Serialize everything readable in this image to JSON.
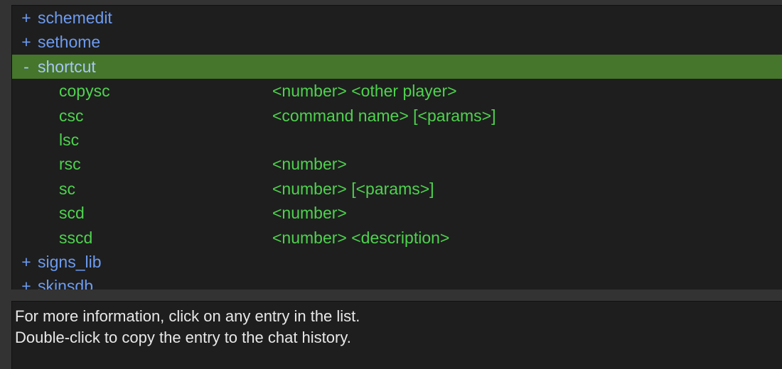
{
  "list": {
    "rows": [
      {
        "kind": "mod",
        "toggle": "+",
        "label": "schemedit",
        "selected": false
      },
      {
        "kind": "mod",
        "toggle": "+",
        "label": "sethome",
        "selected": false
      },
      {
        "kind": "mod",
        "toggle": "-",
        "label": "shortcut",
        "selected": true
      },
      {
        "kind": "command",
        "name": "copysc",
        "params": "<number> <other player>"
      },
      {
        "kind": "command",
        "name": "csc",
        "params": "<command name> [<params>]"
      },
      {
        "kind": "command",
        "name": "lsc",
        "params": ""
      },
      {
        "kind": "command",
        "name": "rsc",
        "params": "<number>"
      },
      {
        "kind": "command",
        "name": "sc",
        "params": "<number> [<params>]"
      },
      {
        "kind": "command",
        "name": "scd",
        "params": "<number>"
      },
      {
        "kind": "command",
        "name": "sscd",
        "params": "<number> <description>"
      },
      {
        "kind": "mod",
        "toggle": "+",
        "label": "signs_lib",
        "selected": false
      },
      {
        "kind": "mod",
        "toggle": "+",
        "label": "skinsdb",
        "selected": false
      }
    ]
  },
  "info": {
    "line1": "For more information, click on any entry in the list.",
    "line2": "Double-click to copy the entry to the chat history."
  },
  "colors": {
    "background": "#333333",
    "panel_background": "#1e1e1e",
    "panel_border": "#111111",
    "selection_green": "#45762b",
    "mod_blue": "#6d9bf0",
    "mod_blue_selected": "#a9c6f7",
    "command_green": "#4ed24e",
    "info_text": "#e8e8e8"
  }
}
